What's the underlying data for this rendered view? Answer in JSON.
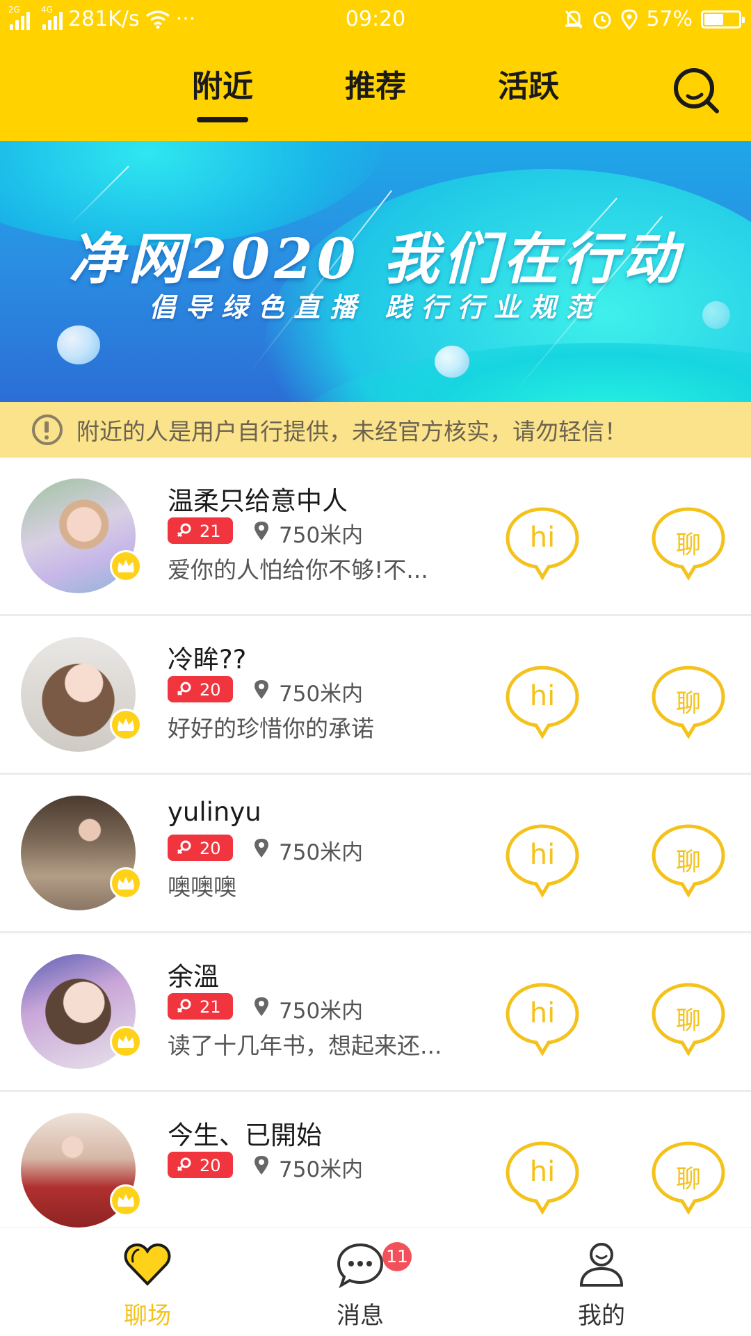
{
  "status_bar": {
    "network_speed": "281K/s",
    "time": "09:20",
    "battery_percent": "57%",
    "battery_level": 0.57,
    "net1": "2G",
    "net2": "4G"
  },
  "header": {
    "tabs": [
      {
        "label": "附近",
        "active": true
      },
      {
        "label": "推荐",
        "active": false
      },
      {
        "label": "活跃",
        "active": false
      }
    ],
    "search_icon": "search-icon"
  },
  "banner": {
    "title": "净网2020 我们在行动",
    "subtitle": "倡导绿色直播 践行行业规范"
  },
  "notice": {
    "text": "附近的人是用户自行提供，未经官方核实，请勿轻信！"
  },
  "users": [
    {
      "name": "温柔只给意中人",
      "age": "21",
      "distance": "750米内",
      "signature": "爱你的人怕给你不够!不...",
      "hi_label": "hi",
      "chat_label": "聊"
    },
    {
      "name": "冷眸??",
      "age": "20",
      "distance": "750米内",
      "signature": "好好的珍惜你的承诺",
      "hi_label": "hi",
      "chat_label": "聊"
    },
    {
      "name": "yulinyu",
      "age": "20",
      "distance": "750米内",
      "signature": "噢噢噢",
      "hi_label": "hi",
      "chat_label": "聊"
    },
    {
      "name": "余溫",
      "age": "21",
      "distance": "750米内",
      "signature": "读了十几年书，想起来还...",
      "hi_label": "hi",
      "chat_label": "聊"
    },
    {
      "name": "今生、已開始",
      "age": "20",
      "distance": "750米内",
      "signature": "",
      "hi_label": "hi",
      "chat_label": "聊"
    }
  ],
  "bottom_nav": {
    "items": [
      {
        "label": "聊场",
        "icon": "heart-icon",
        "active": true
      },
      {
        "label": "消息",
        "icon": "message-icon",
        "active": false,
        "badge": "11"
      },
      {
        "label": "我的",
        "icon": "profile-icon",
        "active": false
      }
    ]
  },
  "colors": {
    "brand_yellow": "#FFD200",
    "notice_bg": "#FAE38A",
    "badge_red": "#F0353E",
    "accent_text": "#F4C21A"
  }
}
